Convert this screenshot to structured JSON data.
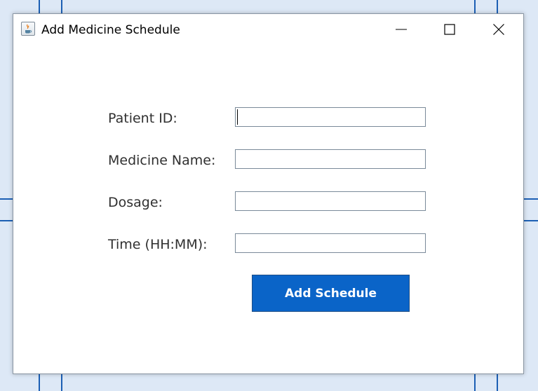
{
  "window": {
    "title": "Add Medicine Schedule"
  },
  "icons": {
    "app": "java-app-icon",
    "minimize": "minimize-icon",
    "maximize": "maximize-icon",
    "close": "close-icon"
  },
  "form": {
    "patient_id": {
      "label": "Patient ID:",
      "value": ""
    },
    "medicine_name": {
      "label": "Medicine Name:",
      "value": ""
    },
    "dosage": {
      "label": "Dosage:",
      "value": ""
    },
    "time": {
      "label": "Time (HH:MM):",
      "value": ""
    }
  },
  "actions": {
    "add_schedule_label": "Add Schedule"
  },
  "colors": {
    "button_background": "#0a64c8",
    "button_text": "#ffffff",
    "desktop_background": "#dde8f6",
    "desktop_lines": "#1c5fb4"
  }
}
